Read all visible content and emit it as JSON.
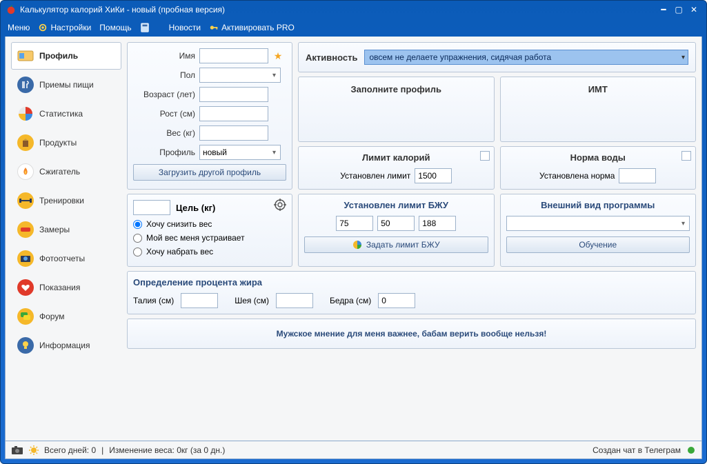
{
  "title": "Калькулятор калорий ХиКи - новый (пробная версия)",
  "menu": {
    "menu": "Меню",
    "settings": "Настройки",
    "help": "Помощь",
    "news": "Новости",
    "activate": "Активировать PRO"
  },
  "sidebar": [
    "Профиль",
    "Приемы пищи",
    "Статистика",
    "Продукты",
    "Сжигатель",
    "Тренировки",
    "Замеры",
    "Фотоотчеты",
    "Показания",
    "Форум",
    "Информация"
  ],
  "profile_form": {
    "name_label": "Имя",
    "gender_label": "Пол",
    "age_label": "Возраст (лет)",
    "height_label": "Рост (см)",
    "weight_label": "Вес (кг)",
    "profile_label": "Профиль",
    "profile_value": "новый",
    "load_btn": "Загрузить другой профиль"
  },
  "goal": {
    "title": "Цель (кг)",
    "opt1": "Хочу снизить вес",
    "opt2": "Мой вес меня устраивает",
    "opt3": "Хочу набрать вес"
  },
  "activity": {
    "label": "Активность",
    "value": "овсем не делаете упражнения, сидячая работа"
  },
  "info_panels": {
    "fill_profile": "Заполните профиль",
    "bmi": "ИМТ",
    "cal_limit_title": "Лимит калорий",
    "cal_limit_label": "Установлен лимит",
    "cal_limit_value": "1500",
    "water_title": "Норма воды",
    "water_label": "Установлена норма",
    "bju_title": "Установлен лимит БЖУ",
    "bju_b": "75",
    "bju_j": "50",
    "bju_u": "188",
    "bju_btn": "Задать лимит БЖУ",
    "appearance_title": "Внешний вид программы",
    "training_btn": "Обучение"
  },
  "fat": {
    "title": "Определение процента жира",
    "waist": "Талия (см)",
    "neck": "Шея (см)",
    "hips": "Бедра (см)",
    "hips_value": "0"
  },
  "quote": "Мужское мнение для меня важнее, бабам верить вообще нельзя!",
  "status": {
    "days": "Всего дней: 0",
    "weight_change": "Изменение веса: 0кг (за 0 дн.)",
    "telegram": "Создан чат в Телеграм"
  }
}
